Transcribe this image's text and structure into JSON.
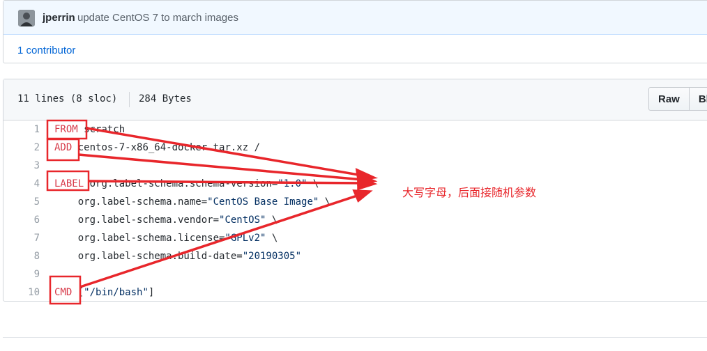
{
  "commit": {
    "author": "jperrin",
    "message": "update CentOS 7 to march images",
    "contributors": "1 contributor"
  },
  "file": {
    "lines_info": "11 lines (8 sloc)",
    "size": "284 Bytes",
    "raw_label": "Raw",
    "blame_label": "Bl"
  },
  "code": [
    {
      "num": "1",
      "kw": "FROM",
      "rest": " scratch"
    },
    {
      "num": "2",
      "kw": "ADD",
      "rest": " centos-7-x86_64-docker.tar.xz /"
    },
    {
      "num": "3",
      "kw": "",
      "rest": ""
    },
    {
      "num": "4",
      "kw": "LABEL",
      "rest": " org.label-schema.schema-version=",
      "str": "\"1.0\"",
      "tail": " \\"
    },
    {
      "num": "5",
      "kw": "",
      "rest": "    org.label-schema.name=",
      "str": "\"CentOS Base Image\"",
      "tail": " \\"
    },
    {
      "num": "6",
      "kw": "",
      "rest": "    org.label-schema.vendor=",
      "str": "\"CentOS\"",
      "tail": " \\"
    },
    {
      "num": "7",
      "kw": "",
      "rest": "    org.label-schema.license=",
      "str": "\"GPLv2\"",
      "tail": " \\"
    },
    {
      "num": "8",
      "kw": "",
      "rest": "    org.label-schema.build-date=",
      "str": "\"20190305\"",
      "tail": ""
    },
    {
      "num": "9",
      "kw": "",
      "rest": ""
    },
    {
      "num": "10",
      "kw": "CMD",
      "rest": " [",
      "str": "\"/bin/bash\"",
      "tail": "]"
    }
  ],
  "annotation": {
    "note": "大写字母，后面接随机参数",
    "color": "#e8262b"
  }
}
